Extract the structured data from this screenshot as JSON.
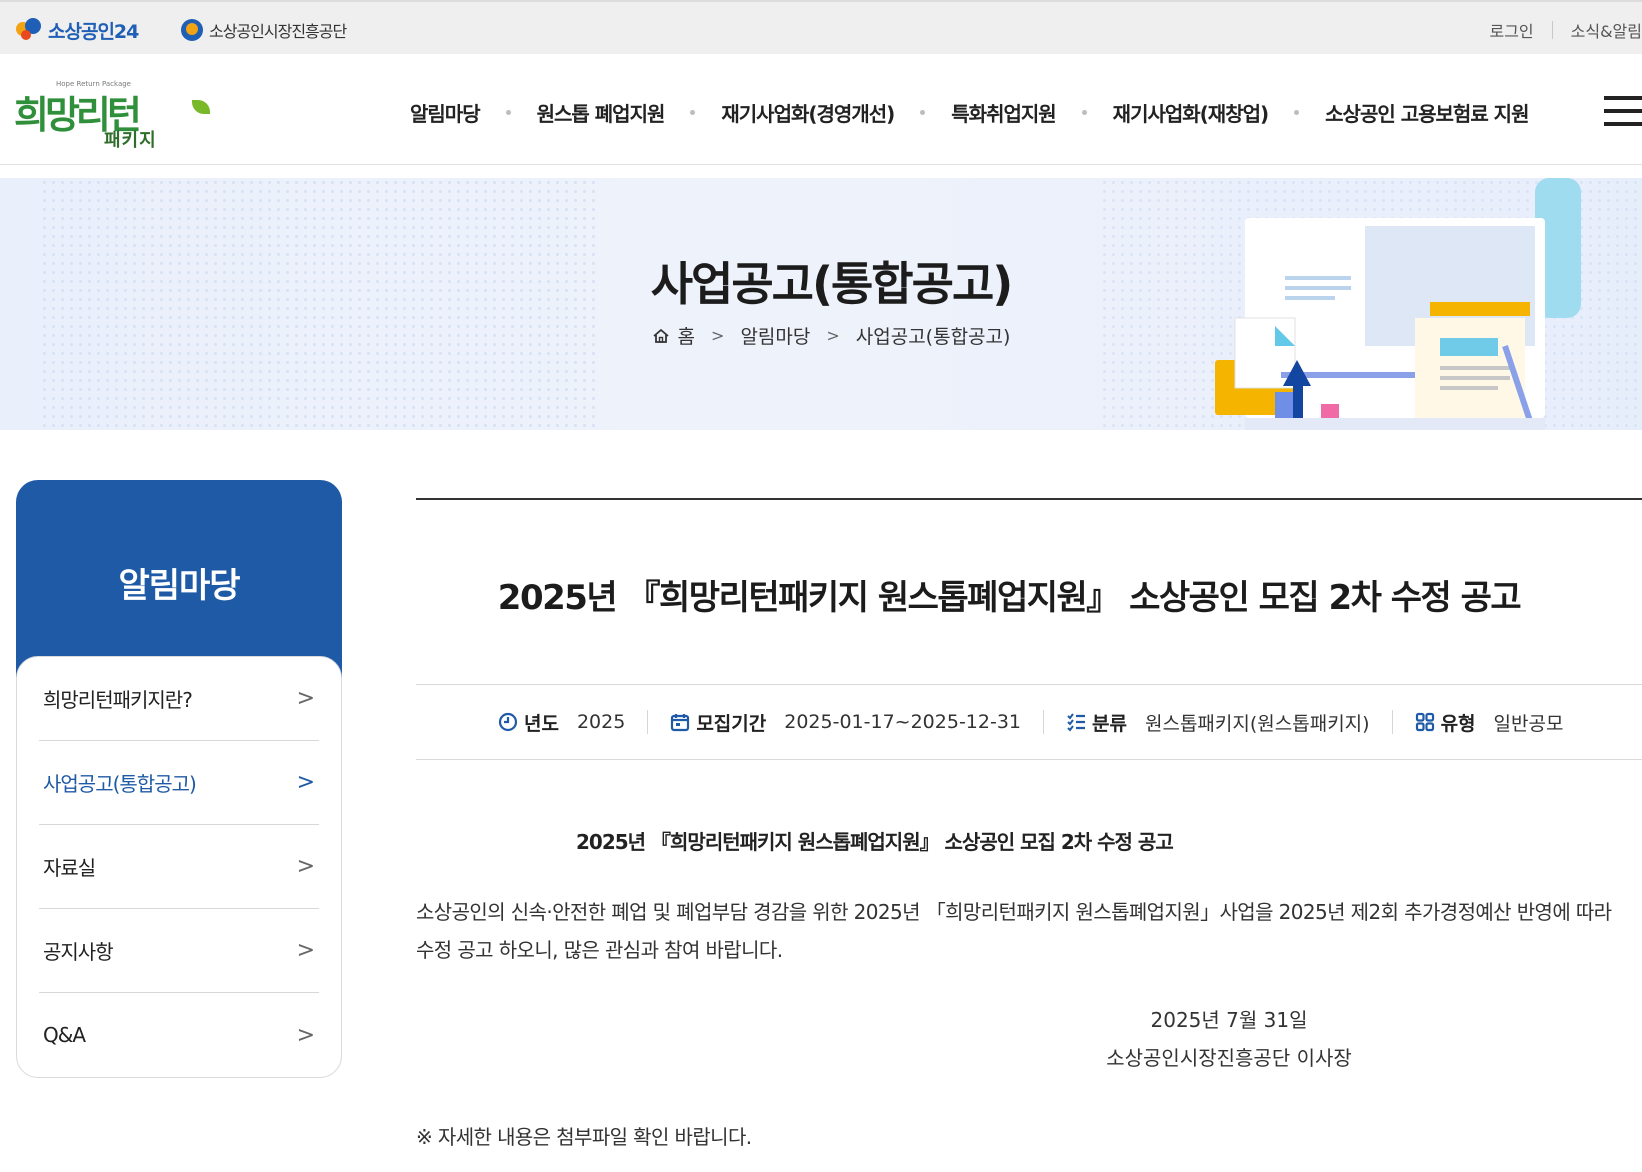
{
  "utility": {
    "logo1_text": "소상공인24",
    "logo2_text": "소상공인시장진흥공단",
    "login": "로그인",
    "news": "소식&알림"
  },
  "brand": {
    "main": "희망리턴",
    "sub": "패키지",
    "tagline": "Hope Return Package"
  },
  "nav": {
    "items": [
      "알림마당",
      "원스톱 폐업지원",
      "재기사업화(경영개선)",
      "특화취업지원",
      "재기사업화(재창업)",
      "소상공인 고용보험료 지원"
    ]
  },
  "hero": {
    "title": "사업공고(통합공고)",
    "breadcrumb": [
      "홈",
      "알림마당",
      "사업공고(통합공고)"
    ]
  },
  "sidebar": {
    "title": "알림마당",
    "items": [
      {
        "label": "희망리턴패키지란?"
      },
      {
        "label": "사업공고(통합공고)"
      },
      {
        "label": "자료실"
      },
      {
        "label": "공지사항"
      },
      {
        "label": "Q&A"
      }
    ]
  },
  "post": {
    "title": "2025년 『희망리턴패키지 원스톱폐업지원』 소상공인 모집 2차 수정 공고",
    "meta": {
      "year_label": "년도",
      "year_value": "2025",
      "period_label": "모집기간",
      "period_value": "2025-01-17~2025-12-31",
      "category_label": "분류",
      "category_value": "원스톱패키지(원스톱패키지)",
      "type_label": "유형",
      "type_value": "일반공모"
    },
    "body": {
      "subtitle": "2025년 『희망리턴패키지 원스톱폐업지원』 소상공인 모집 2차 수정 공고",
      "line1": "소상공인의 신속·안전한 폐업 및 폐업부담 경감을 위한 2025년 「희망리턴패키지 원스톱폐업지원」사업을 2025년 제2회 추가경정예산 반영에 따라",
      "line2": "수정 공고 하오니, 많은 관심과 참여 바랍니다.",
      "date": "2025년 7월 31일",
      "signer": "소상공인시장진흥공단 이사장",
      "note": "※ 자세한 내용은 첨부파일 확인 바랍니다."
    }
  },
  "colors": {
    "primary": "#1f5aa6",
    "brand_green": "#2f8f3a",
    "hero_bg": "#eaf0fb"
  }
}
